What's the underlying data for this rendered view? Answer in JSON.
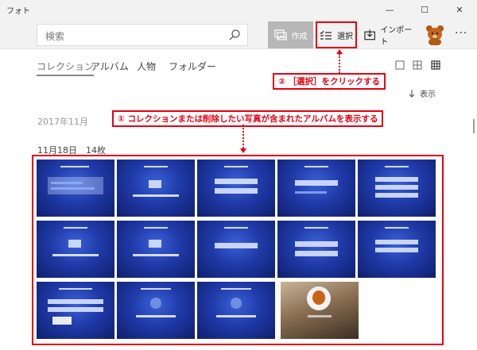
{
  "window": {
    "title": "フォト",
    "controls": [
      "—",
      "☐",
      "✕"
    ]
  },
  "toolbar": {
    "search_placeholder": "検索",
    "create_label": "作成",
    "select_label": "選択",
    "import_label": "インポート",
    "more_label": "···"
  },
  "tabs": [
    {
      "label": "コレクション",
      "active": true
    },
    {
      "label": "アルバム",
      "active": false
    },
    {
      "label": "人物",
      "active": false
    },
    {
      "label": "フォルダー",
      "active": false
    }
  ],
  "view_modes": [
    "large-thumbnail-icon",
    "medium-thumbnail-icon",
    "small-thumbnail-icon"
  ],
  "sort": {
    "label": "表示"
  },
  "collection": {
    "month": "2017年11月",
    "day_heading": "11月18日　14枚",
    "photo_count": 14
  },
  "annotations": {
    "step1": "① コレクションまたは削除したい写真が含まれたアルバムを表示する",
    "step2": "② ［選択］をクリックする"
  },
  "colors": {
    "accent_red": "#e60012",
    "create_button_bg": "#b7b7b7",
    "toolbar_bg": "#f2f2f2"
  }
}
